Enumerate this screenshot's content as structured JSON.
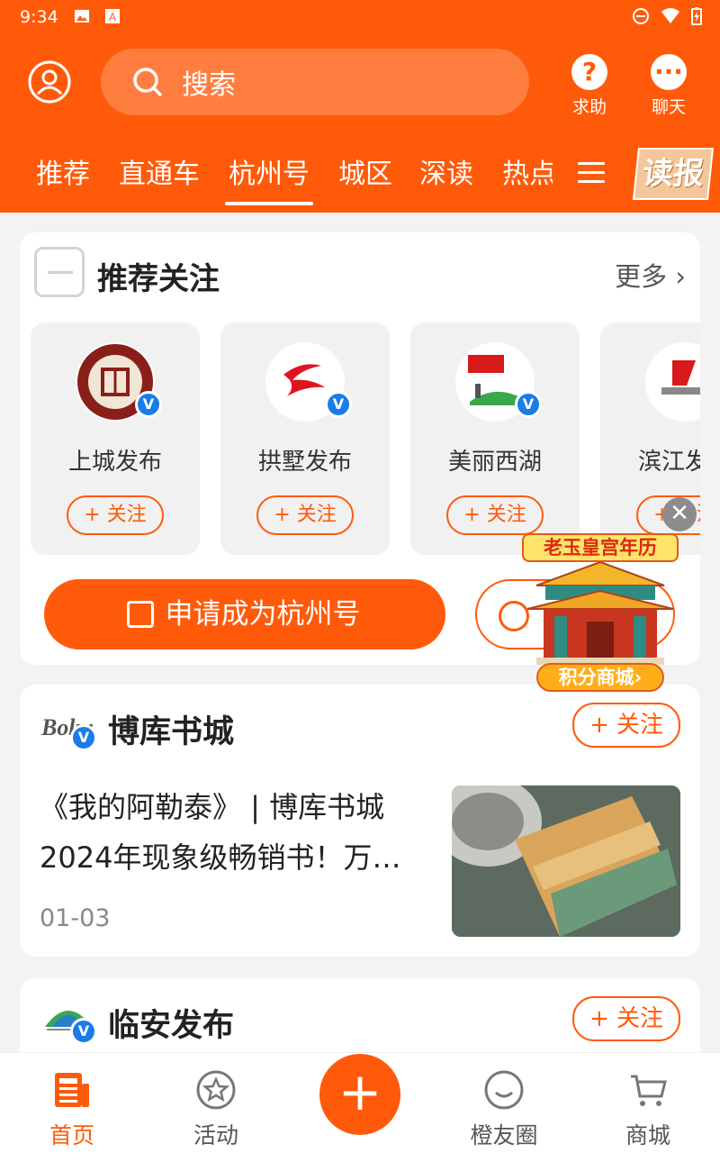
{
  "status": {
    "time": "9:34"
  },
  "header": {
    "search_placeholder": "搜索",
    "help_label": "求助",
    "chat_label": "聊天",
    "tabs": [
      "推荐",
      "直通车",
      "杭州号",
      "城区",
      "深读",
      "热点"
    ],
    "active_tab": "杭州号",
    "dubao_label": "读报"
  },
  "recommend": {
    "title": "推荐关注",
    "more": "更多",
    "accounts": [
      {
        "name": "上城发布",
        "follow": "+ 关注"
      },
      {
        "name": "拱墅发布",
        "follow": "+ 关注"
      },
      {
        "name": "美丽西湖",
        "follow": "+ 关注"
      },
      {
        "name": "滨江发布",
        "follow": "+ 关注"
      }
    ],
    "apply_label": "申请成为杭州号"
  },
  "ad": {
    "top_text": "老玉皇宫年历",
    "bottom_text": "积分商城›"
  },
  "feed": [
    {
      "source": "博库书城",
      "follow": "+ 关注",
      "headline": "《我的阿勒泰》 | 博库书城2024年现象级畅销书！万…",
      "date": "01-03"
    },
    {
      "source": "临安发布",
      "follow": "+ 关注"
    }
  ],
  "bottom_nav": [
    {
      "label": "首页"
    },
    {
      "label": "活动"
    },
    {
      "label": "橙友圈"
    },
    {
      "label": "商城"
    }
  ],
  "colors": {
    "brand": "#ff5a0a",
    "verified": "#1a7ce8"
  }
}
